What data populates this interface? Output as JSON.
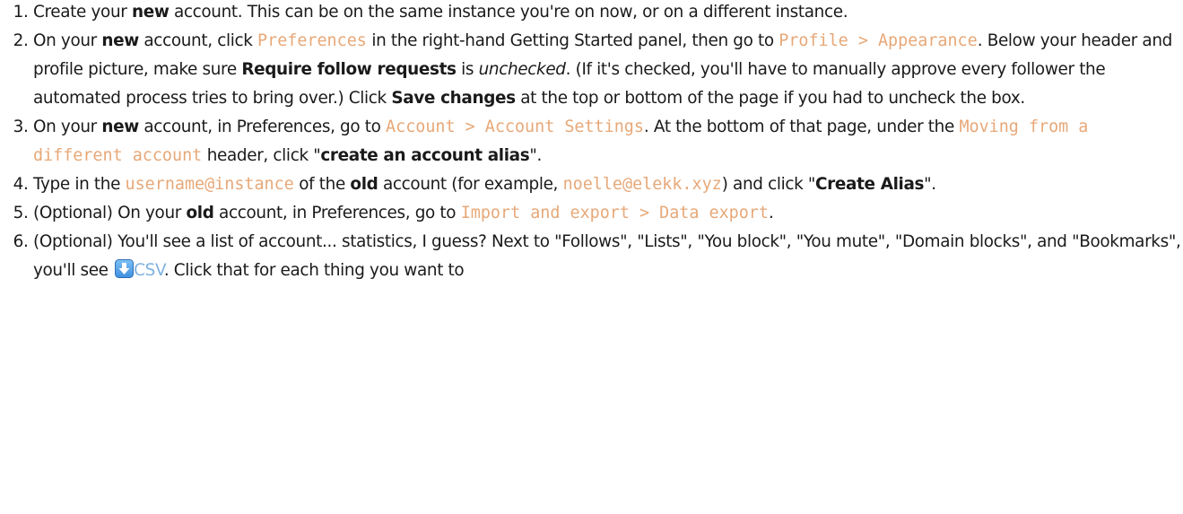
{
  "steps": [
    {
      "parts": [
        {
          "t": "Create your "
        },
        {
          "t": "new",
          "s": "b"
        },
        {
          "t": " account. This can be on the same instance you're on now, or on a different instance."
        }
      ]
    },
    {
      "parts": [
        {
          "t": "On your "
        },
        {
          "t": "new",
          "s": "b"
        },
        {
          "t": " account, click "
        },
        {
          "t": "Preferences",
          "s": "code"
        },
        {
          "t": " in the right-hand Getting Started panel, then go to "
        },
        {
          "t": "Profile > Appearance",
          "s": "code"
        },
        {
          "t": ". Below your header and profile picture, make sure "
        },
        {
          "t": "Require follow requests",
          "s": "b"
        },
        {
          "t": " is "
        },
        {
          "t": "unchecked",
          "s": "i"
        },
        {
          "t": ". (If it's checked, you'll have to manually approve every follower the automated process tries to bring over.) Click "
        },
        {
          "t": "Save changes",
          "s": "b"
        },
        {
          "t": " at the top or bottom of the page if you had to uncheck the box."
        }
      ]
    },
    {
      "parts": [
        {
          "t": "On your "
        },
        {
          "t": "new",
          "s": "b"
        },
        {
          "t": " account, in Preferences, go to "
        },
        {
          "t": "Account > Account Settings",
          "s": "code"
        },
        {
          "t": ". At the bottom of that page, under the "
        },
        {
          "t": "Moving from a different account",
          "s": "code"
        },
        {
          "t": " header, click \""
        },
        {
          "t": "create an account alias",
          "s": "b"
        },
        {
          "t": "\"."
        }
      ]
    },
    {
      "parts": [
        {
          "t": "Type in the "
        },
        {
          "t": "username@instance",
          "s": "code"
        },
        {
          "t": " of the "
        },
        {
          "t": "old",
          "s": "b"
        },
        {
          "t": " account (for example, "
        },
        {
          "t": "noelle@elekk.xyz",
          "s": "code"
        },
        {
          "t": ") and click \""
        },
        {
          "t": "Create Alias",
          "s": "b"
        },
        {
          "t": "\"."
        }
      ]
    },
    {
      "parts": [
        {
          "t": "(Optional) On your "
        },
        {
          "t": "old",
          "s": "b"
        },
        {
          "t": " account, in Preferences, go to "
        },
        {
          "t": "Import and export > Data export",
          "s": "code"
        },
        {
          "t": "."
        }
      ]
    },
    {
      "parts": [
        {
          "t": "(Optional) You'll see a list of account... statistics, I guess? Next to \"Follows\", \"Lists\", \"You block\", \"You mute\", \"Domain blocks\", and \"Bookmarks\", you'll see "
        },
        {
          "t": "download-icon",
          "s": "icon"
        },
        {
          "t": "CSV",
          "s": "link"
        },
        {
          "t": ". Click that for each thing you want to"
        }
      ]
    }
  ],
  "colors": {
    "code": "#e7a878",
    "link": "#7fb2e2",
    "icon_blue": "#3e8fe0"
  }
}
